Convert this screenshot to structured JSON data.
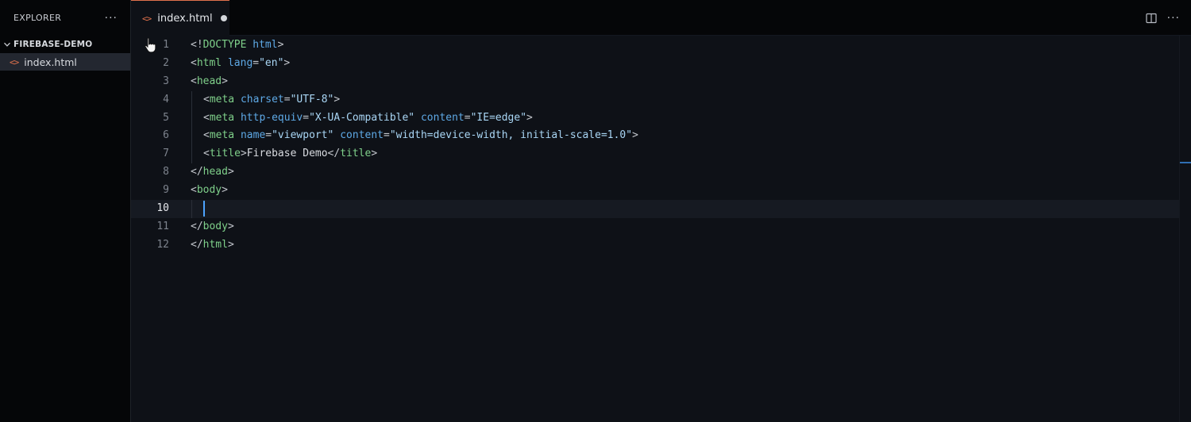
{
  "explorer": {
    "title": "EXPLORER",
    "more_label": "···",
    "folder": "FIREBASE-DEMO",
    "files": [
      {
        "name": "index.html",
        "icon": "html-file-icon"
      }
    ]
  },
  "editor": {
    "tab": {
      "label": "index.html",
      "modified": true
    },
    "actions": {
      "more_label": "···"
    },
    "active_line": 10,
    "line_numbers": [
      "1",
      "2",
      "3",
      "4",
      "5",
      "6",
      "7",
      "8",
      "9",
      "10",
      "11",
      "12"
    ],
    "lines": [
      {
        "indent": 0,
        "tokens": [
          [
            "punc",
            "<!"
          ],
          [
            "doctype",
            "DOCTYPE"
          ],
          [
            "text",
            " "
          ],
          [
            "kw",
            "html"
          ],
          [
            "punc",
            ">"
          ]
        ]
      },
      {
        "indent": 0,
        "tokens": [
          [
            "punc",
            "<"
          ],
          [
            "tag",
            "html"
          ],
          [
            "text",
            " "
          ],
          [
            "attr",
            "lang"
          ],
          [
            "eq",
            "="
          ],
          [
            "str",
            "\"en\""
          ],
          [
            "punc",
            ">"
          ]
        ]
      },
      {
        "indent": 0,
        "tokens": [
          [
            "punc",
            "<"
          ],
          [
            "tag",
            "head"
          ],
          [
            "punc",
            ">"
          ]
        ]
      },
      {
        "indent": 1,
        "tokens": [
          [
            "punc",
            "<"
          ],
          [
            "tag",
            "meta"
          ],
          [
            "text",
            " "
          ],
          [
            "attr",
            "charset"
          ],
          [
            "eq",
            "="
          ],
          [
            "str",
            "\"UTF-8\""
          ],
          [
            "punc",
            ">"
          ]
        ]
      },
      {
        "indent": 1,
        "tokens": [
          [
            "punc",
            "<"
          ],
          [
            "tag",
            "meta"
          ],
          [
            "text",
            " "
          ],
          [
            "attr",
            "http-equiv"
          ],
          [
            "eq",
            "="
          ],
          [
            "str",
            "\"X-UA-Compatible\""
          ],
          [
            "text",
            " "
          ],
          [
            "attr",
            "content"
          ],
          [
            "eq",
            "="
          ],
          [
            "str",
            "\"IE=edge\""
          ],
          [
            "punc",
            ">"
          ]
        ]
      },
      {
        "indent": 1,
        "tokens": [
          [
            "punc",
            "<"
          ],
          [
            "tag",
            "meta"
          ],
          [
            "text",
            " "
          ],
          [
            "attr",
            "name"
          ],
          [
            "eq",
            "="
          ],
          [
            "str",
            "\"viewport\""
          ],
          [
            "text",
            " "
          ],
          [
            "attr",
            "content"
          ],
          [
            "eq",
            "="
          ],
          [
            "str",
            "\"width=device-width, initial-scale=1.0\""
          ],
          [
            "punc",
            ">"
          ]
        ]
      },
      {
        "indent": 1,
        "tokens": [
          [
            "punc",
            "<"
          ],
          [
            "tag",
            "title"
          ],
          [
            "punc",
            ">"
          ],
          [
            "text",
            "Firebase Demo"
          ],
          [
            "punc",
            "</"
          ],
          [
            "tag",
            "title"
          ],
          [
            "punc",
            ">"
          ]
        ]
      },
      {
        "indent": 0,
        "tokens": [
          [
            "punc",
            "</"
          ],
          [
            "tag",
            "head"
          ],
          [
            "punc",
            ">"
          ]
        ]
      },
      {
        "indent": 0,
        "tokens": [
          [
            "punc",
            "<"
          ],
          [
            "tag",
            "body"
          ],
          [
            "punc",
            ">"
          ]
        ]
      },
      {
        "indent": 1,
        "tokens": [],
        "caret": true
      },
      {
        "indent": 0,
        "tokens": [
          [
            "punc",
            "</"
          ],
          [
            "tag",
            "body"
          ],
          [
            "punc",
            ">"
          ]
        ]
      },
      {
        "indent": 0,
        "tokens": [
          [
            "punc",
            "</"
          ],
          [
            "tag",
            "html"
          ],
          [
            "punc",
            ">"
          ]
        ]
      }
    ]
  },
  "colors": {
    "accent": "#e0714c",
    "caret": "#4da3ff",
    "tag": "#7fd08a",
    "attribute": "#5ea9e6",
    "string": "#a9d6f5"
  }
}
